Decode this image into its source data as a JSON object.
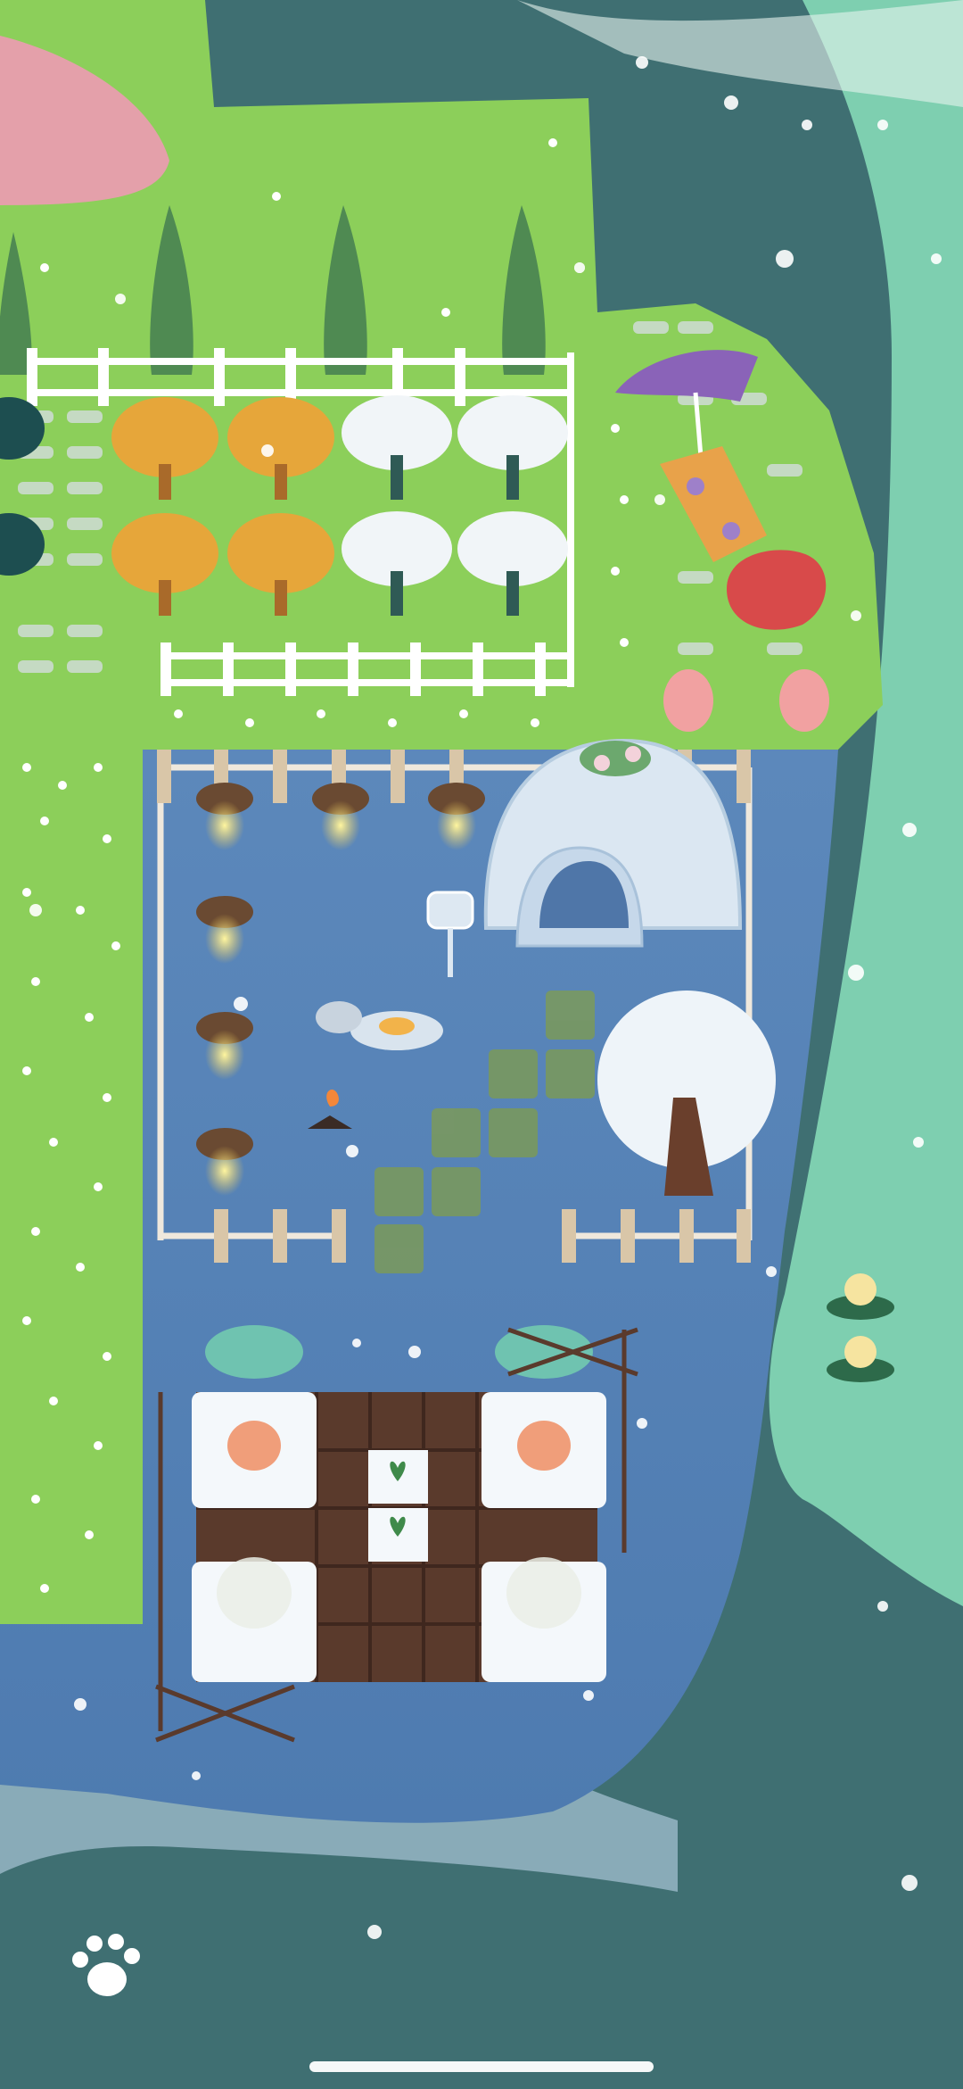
{
  "game": {
    "scene": "island-garden",
    "weather": "snow",
    "colors": {
      "grass": "#8ccf5a",
      "pond": "#5a87b8",
      "sea_light": "#7ecfb0",
      "sea_deep": "#3f6f72",
      "chocolate": "#5a3a2c",
      "snow": "#f4f8fb"
    },
    "controls": {
      "menu_button_icon": "paw-icon"
    }
  }
}
